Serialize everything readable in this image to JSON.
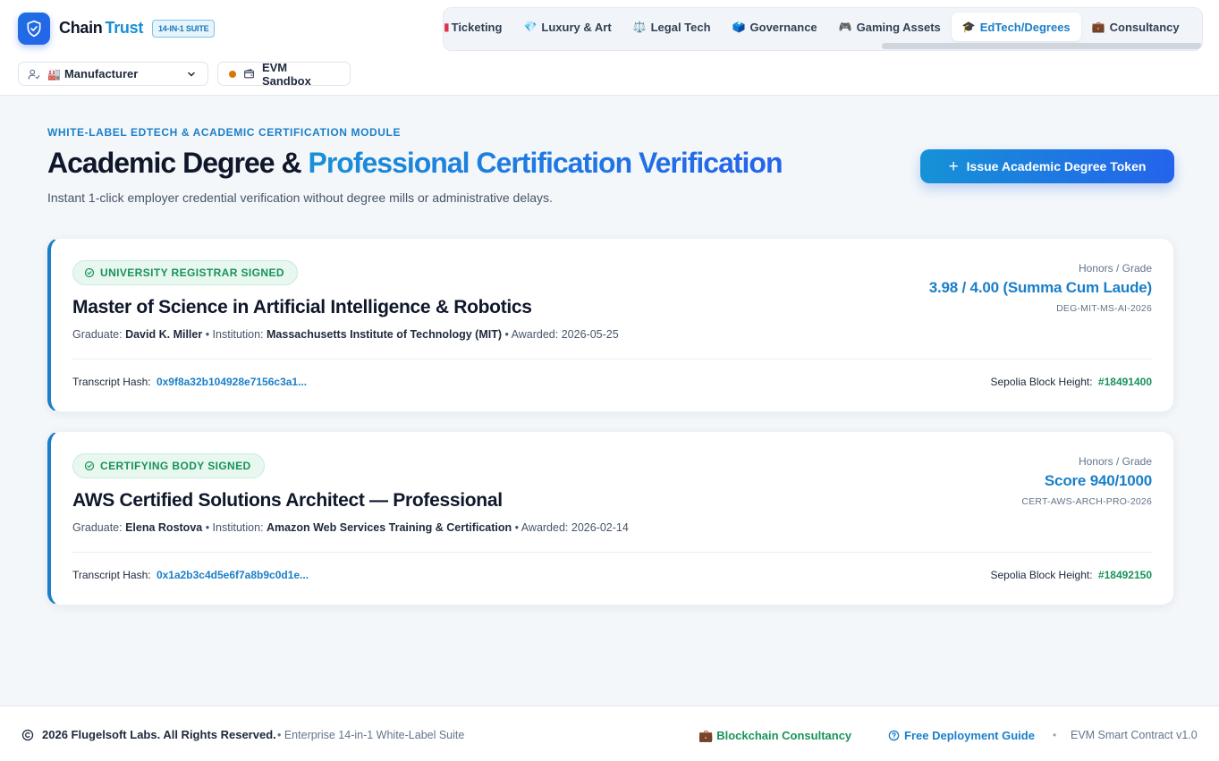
{
  "header": {
    "brand_primary": "Chain",
    "brand_secondary": "Trust",
    "suite_badge": "14-IN-1 SUITE",
    "logo_icon": "shield-check-icon",
    "tabs": [
      {
        "label": "Ticketing",
        "icon": "ticket-icon"
      },
      {
        "label": "Luxury & Art",
        "icon": "gem-icon"
      },
      {
        "label": "Legal Tech",
        "icon": "scales-icon"
      },
      {
        "label": "Governance",
        "icon": "ballot-box-icon"
      },
      {
        "label": "Gaming Assets",
        "icon": "gamepad-icon"
      },
      {
        "label": "EdTech/Degrees",
        "icon": "graduation-cap-icon"
      },
      {
        "label": "Consultancy",
        "icon": "briefcase-icon"
      }
    ],
    "active_tab": "EdTech/Degrees",
    "role": {
      "label": "Manufacturer",
      "icon": "user-check-icon",
      "emoji": "factory-icon"
    },
    "network": {
      "label": "EVM Sandbox",
      "status_color": "#d97706",
      "icon": "wallet-icon"
    }
  },
  "main": {
    "eyebrow": "WHITE-LABEL EDTECH & ACADEMIC CERTIFICATION MODULE",
    "title_part1": "Academic Degree &",
    "title_part2": "Professional Certification Verification",
    "subtitle": "Instant 1-click employer credential verification without degree mills or administrative delays.",
    "issue_button": "Issue Academic Degree Token",
    "grade_label": "Honors / Grade",
    "graduate_label": "Graduate:",
    "institution_label": "• Institution:",
    "awarded_label": "• Awarded:",
    "hash_label": "Transcript Hash:",
    "block_label": "Sepolia Block Height:",
    "credentials": [
      {
        "signature": "UNIVERSITY REGISTRAR SIGNED",
        "title": "Master of Science in Artificial Intelligence & Robotics",
        "graduate": "David K. Miller",
        "institution": "Massachusetts Institute of Technology (MIT)",
        "awarded": "2026-05-25",
        "grade": "3.98 / 4.00 (Summa Cum Laude)",
        "credential_id": "DEG-MIT-MS-AI-2026",
        "transcript_hash": "0x9f8a32b104928e7156c3a1...",
        "block_height": "#18491400"
      },
      {
        "signature": "CERTIFYING BODY SIGNED",
        "title": "AWS Certified Solutions Architect — Professional",
        "graduate": "Elena Rostova",
        "institution": "Amazon Web Services Training & Certification",
        "awarded": "2026-02-14",
        "grade": "Score 940/1000",
        "credential_id": "CERT-AWS-ARCH-PRO-2026",
        "transcript_hash": "0x1a2b3c4d5e6f7a8b9c0d1e...",
        "block_height": "#18492150"
      }
    ]
  },
  "footer": {
    "copyright": "2026 Flugelsoft Labs. All Rights Reserved.",
    "edition": "• Enterprise 14-in-1 White-Label Suite",
    "consultancy_link": "Blockchain Consultancy",
    "guide_link": "Free Deployment Guide",
    "separator": "•",
    "version": "EVM Smart Contract v1.0"
  },
  "colors": {
    "accent": "#1a7fc9",
    "success": "#17935a",
    "primary_gradient_end": "#2563eb"
  }
}
